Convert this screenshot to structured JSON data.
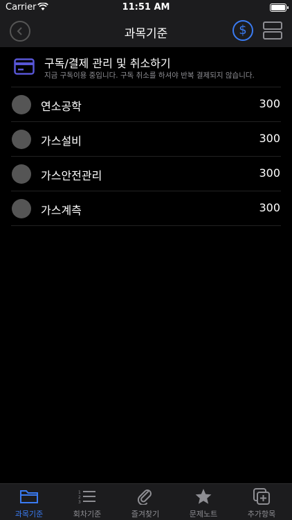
{
  "status": {
    "carrier": "Carrier",
    "time": "11:51 AM"
  },
  "nav": {
    "title": "과목기준",
    "dollar_symbol": "$"
  },
  "subscription": {
    "title": "구독/결제 관리 및 취소하기",
    "description": "지금 구독이용 중입니다. 구독 취소를 하셔야 반복 결제되지 않습니다."
  },
  "subjects": [
    {
      "name": "연소공학",
      "count": "300"
    },
    {
      "name": "가스설비",
      "count": "300"
    },
    {
      "name": "가스안전관리",
      "count": "300"
    },
    {
      "name": "가스계측",
      "count": "300"
    }
  ],
  "tabs": [
    {
      "label": "과목기준",
      "icon": "folder-icon"
    },
    {
      "label": "회차기준",
      "icon": "numbered-list-icon"
    },
    {
      "label": "즐겨찾기",
      "icon": "paperclip-icon"
    },
    {
      "label": "문제노트",
      "icon": "star-icon"
    },
    {
      "label": "추가항목",
      "icon": "add-square-icon"
    }
  ],
  "colors": {
    "accent": "#3a7bf2",
    "card_icon": "#5856d6",
    "inactive": "#8e8e93"
  }
}
